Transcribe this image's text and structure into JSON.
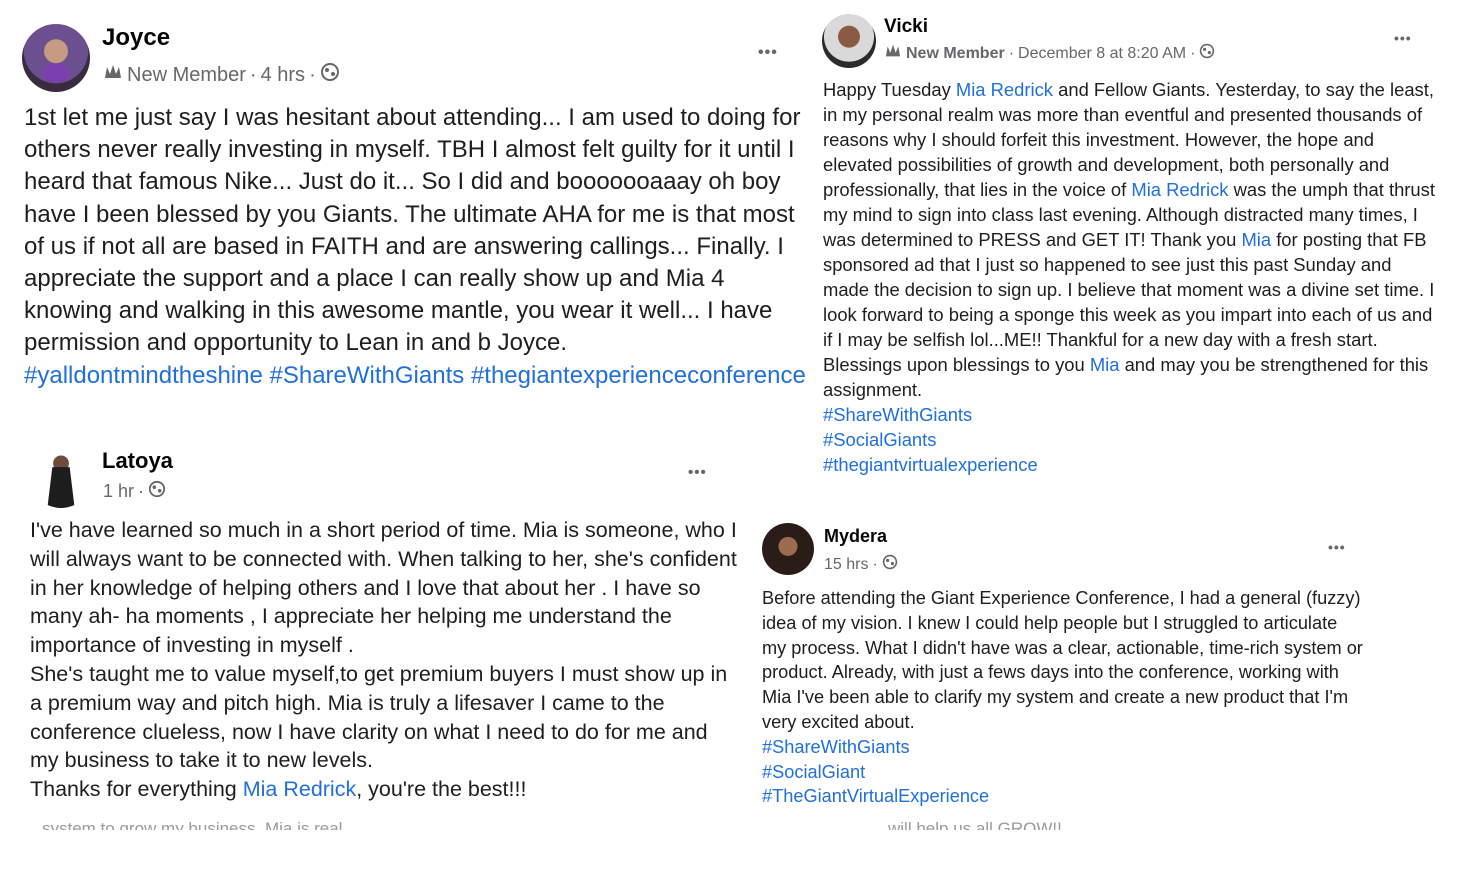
{
  "posts": {
    "joyce": {
      "name": "Joyce",
      "badge": "New Member",
      "time": "4 hrs",
      "paragraphs": [
        "1st let me just say I was hesitant about attending... I am used to doing for others never really investing in myself.  TBH I almost felt guilty for it until I heard that famous Nike... Just do it... So I did and booooooaaay oh boy have I been blessed by you Giants. The ultimate AHA for me is that most of us if not all are based in FAITH and are answering callings... Finally. I appreciate the support and a place I can really show up and Mia 4 knowing and walking in this awesome mantle, you wear it well... I have permission and opportunity to Lean in and b Joyce. "
      ],
      "tags": [
        "#yalldontmindtheshine",
        "#ShareWithGiants",
        "#thegiantexperienceconference"
      ]
    },
    "vicki": {
      "name": "Vicki",
      "badge": "New Member",
      "time": "December 8 at 8:20 AM",
      "segments": [
        {
          "t": "Happy Tuesday "
        },
        {
          "t": "Mia Redrick",
          "m": true
        },
        {
          "t": " and Fellow Giants. Yesterday, to say the least, in my personal realm was more than eventful and presented thousands of reasons why I should forfeit this investment. However, the hope and elevated possibilities of growth and development, both personally and professionally, that lies in the voice of "
        },
        {
          "t": "Mia Redrick",
          "m": true
        },
        {
          "t": " was the umph that thrust my mind to sign into class last evening. Although distracted many times, I was determined to PRESS and GET IT! Thank you "
        },
        {
          "t": "Mia",
          "m": true
        },
        {
          "t": " for posting that FB sponsored ad that I just so happened to see just this past Sunday and made the decision to sign up. I believe that moment was a divine set time. I look forward to being a sponge this week as you impart into each of us and if I may be selfish lol...ME!! Thankful for a new day with a fresh start. Blessings upon blessings to you "
        },
        {
          "t": "Mia",
          "m": true
        },
        {
          "t": " and may you be strengthened for this assignment."
        }
      ],
      "tags": [
        "#ShareWithGiants",
        "#SocialGiants",
        "#thegiantvirtualexperience"
      ]
    },
    "latoya": {
      "name": "Latoya",
      "time": "1 hr",
      "paragraphs": [
        "I've have learned so much in a short period of time. Mia is someone, who I will always want to be connected with. When talking to her, she's confident in her knowledge of helping others and I love that about her . I have so many ah- ha moments , I appreciate her helping me understand the importance of investing in myself .",
        "She's taught me to value myself,to get premium buyers I must show up in a premium way and pitch high. Mia is truly a lifesaver I came to the conference clueless, now I have clarity on what I need to do for me and my business to take it to new levels."
      ],
      "closing_prefix": "Thanks for everything ",
      "closing_mention": "Mia Redrick",
      "closing_suffix": ", you're the best!!!"
    },
    "mydera": {
      "name": "Mydera",
      "time": "15 hrs",
      "paragraphs": [
        "Before attending the Giant Experience Conference, I had a general (fuzzy) idea of my vision. I knew I could help people but I struggled to articulate my process. What I didn't have was a clear, actionable, time-rich system or product. Already, with just a fews days into the conference, working with Mia I've been able to clarify my system and create a new product that I'm very excited about."
      ],
      "tags": [
        "#ShareWithGiants",
        "#SocialGiant",
        "#TheGiantVirtualExperience"
      ]
    }
  },
  "more_label": "•••",
  "ghost_text": {
    "left": "system to grow my business. Mia is real.",
    "right": "will help us all GROW!!"
  },
  "colors": {
    "text": "#1c1e21",
    "meta": "#65676b",
    "link": "#216fdb"
  },
  "icons": {
    "member": "new-member-badge-icon",
    "audience": "globe-icon",
    "menu": "more-options-icon"
  }
}
